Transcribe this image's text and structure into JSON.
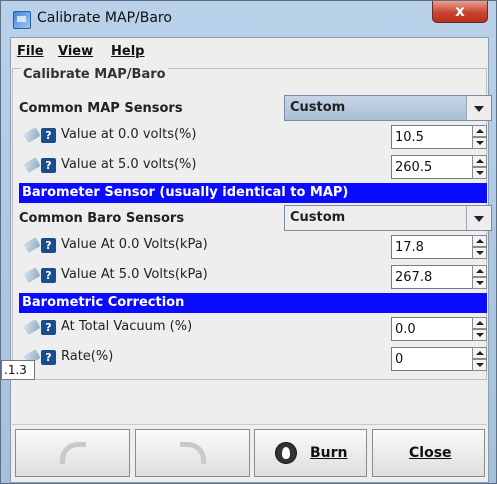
{
  "window": {
    "title": "Calibrate MAP/Baro",
    "close_glyph": "x"
  },
  "menu": {
    "file": "File",
    "view": "View",
    "help": "Help"
  },
  "panel": {
    "title": "Calibrate MAP/Baro"
  },
  "map_sensors": {
    "label": "Common MAP Sensors",
    "selected": "Custom",
    "fields": [
      {
        "label": "Value at 0.0 volts(%)",
        "value": "10.5"
      },
      {
        "label": "Value at 5.0 volts(%)",
        "value": "260.5"
      }
    ]
  },
  "baro_section": {
    "title": "Barometer Sensor (usually identical to MAP)"
  },
  "baro_sensors": {
    "label": "Common Baro Sensors",
    "selected": "Custom",
    "fields": [
      {
        "label": "Value At 0.0 Volts(kPa)",
        "value": "17.8"
      },
      {
        "label": "Value At 5.0 Volts(kPa)",
        "value": "267.8"
      }
    ]
  },
  "correction_section": {
    "title": "Barometric Correction"
  },
  "correction": {
    "fields": [
      {
        "label": "At Total Vacuum (%)",
        "value": "0.0"
      },
      {
        "label": "Rate(%)",
        "value": "0"
      }
    ]
  },
  "tooltip": {
    "text": ".1.3"
  },
  "buttons": {
    "burn": "Burn",
    "close": "Close"
  },
  "icons": {
    "app": "calibrate-app-icon",
    "pencil": "pencil-icon",
    "help": "help-icon",
    "undo": "undo-icon",
    "redo": "redo-icon",
    "burn": "burn-icon"
  },
  "colors": {
    "section_bar": "#0b0bff",
    "select_bg": "#b5c9df"
  }
}
